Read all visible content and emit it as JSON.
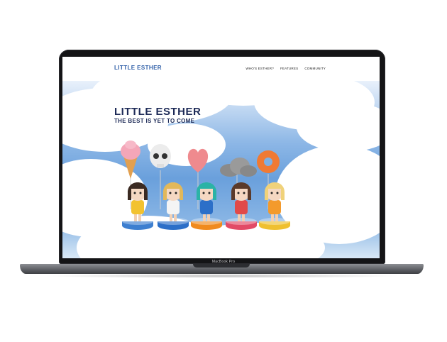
{
  "nav": {
    "logo": "LITTLE ESTHER",
    "menu": [
      "WHO'S ESTHER?",
      "FEATURES",
      "COMMUNITY"
    ]
  },
  "hero": {
    "title": "LITTLE ESTHER",
    "subtitle": "THE BEST IS YET TO COME"
  },
  "device": {
    "label": "MacBook Pro"
  },
  "figures": [
    {
      "prop": "ice-cream-icon",
      "base_color": "#3d7fd0",
      "hair": "#3a2a22",
      "outfit": "#f2c230"
    },
    {
      "prop": "skull-icon",
      "base_color": "#2c6fc8",
      "hair": "#e2b85a",
      "outfit": "#f4f4f4"
    },
    {
      "prop": "heart-icon",
      "base_color": "#f08a1e",
      "hair": "#2bb3a6",
      "outfit": "#2c6fc8"
    },
    {
      "prop": "cloud-icon",
      "base_color": "#e24a66",
      "hair": "#5a3a2a",
      "outfit": "#e14a4a"
    },
    {
      "prop": "donut-icon",
      "base_color": "#efc030",
      "hair": "#f0d27a",
      "outfit": "#f39a2c"
    }
  ]
}
